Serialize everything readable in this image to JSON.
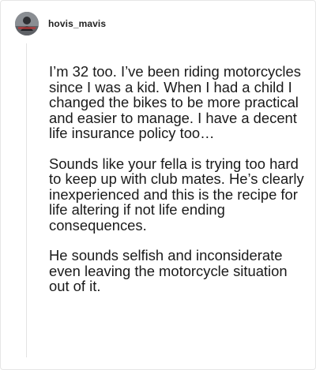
{
  "post": {
    "username": "hovis_mavis",
    "avatar_icon": "user-avatar-icon",
    "paragraphs": [
      "I’m 32 too. I’ve been riding motorcycles since I was a kid. When I had a child I changed the bikes to be more practical and easier to manage. I have a decent life insurance policy too…",
      "Sounds like your fella is trying too hard to keep up with club mates. He’s clearly inexperienced and this is the recipe for life altering if not life ending consequences.",
      "He sounds selfish and inconsiderate even leaving the motorcycle situation out of it."
    ]
  },
  "colors": {
    "background": "#ffffff",
    "text": "#1a1a1a",
    "username": "#222222",
    "divider": "#e3e3e3"
  }
}
